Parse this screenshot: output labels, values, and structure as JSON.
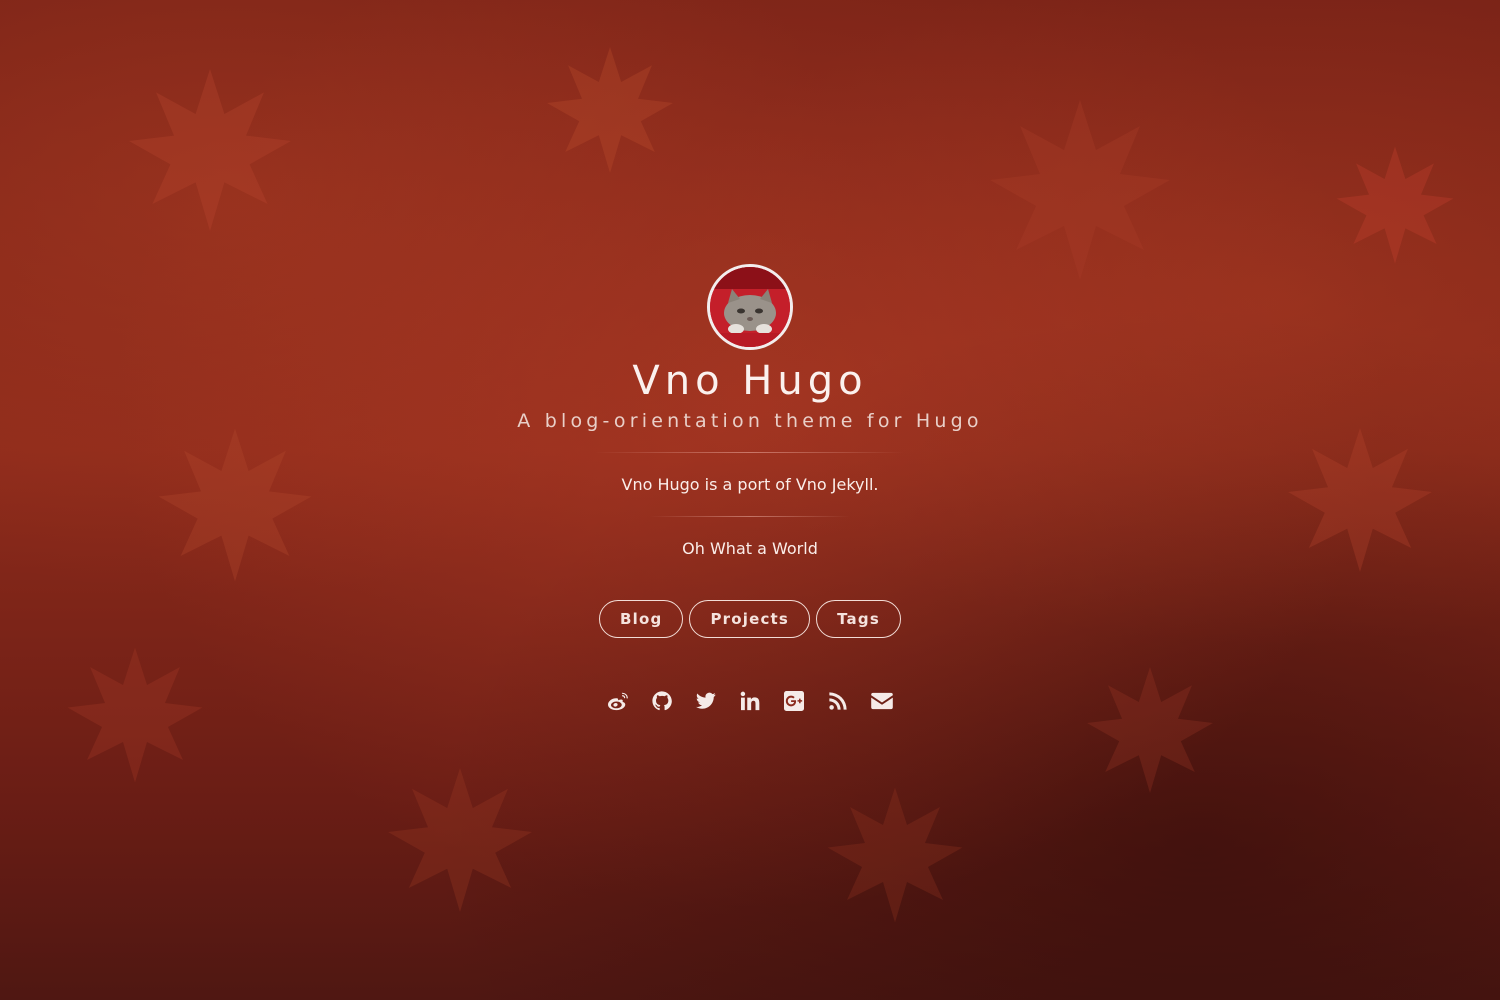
{
  "site": {
    "title": "Vno Hugo",
    "subtitle": "A blog-orientation theme for Hugo",
    "description": "Vno Hugo is a port of Vno Jekyll.",
    "tagline": "Oh What a World"
  },
  "avatar": {
    "icon": "kitten-avatar"
  },
  "nav": {
    "blog": "Blog",
    "projects": "Projects",
    "tags": "Tags"
  },
  "social": [
    {
      "icon": "weibo-icon"
    },
    {
      "icon": "github-icon"
    },
    {
      "icon": "twitter-icon"
    },
    {
      "icon": "linkedin-icon"
    },
    {
      "icon": "google-plus-icon"
    },
    {
      "icon": "rss-icon"
    },
    {
      "icon": "email-icon"
    }
  ],
  "colors": {
    "background": "#7a2317",
    "text": "#f4e6e2",
    "avatar_ring": "#f2eeee"
  }
}
